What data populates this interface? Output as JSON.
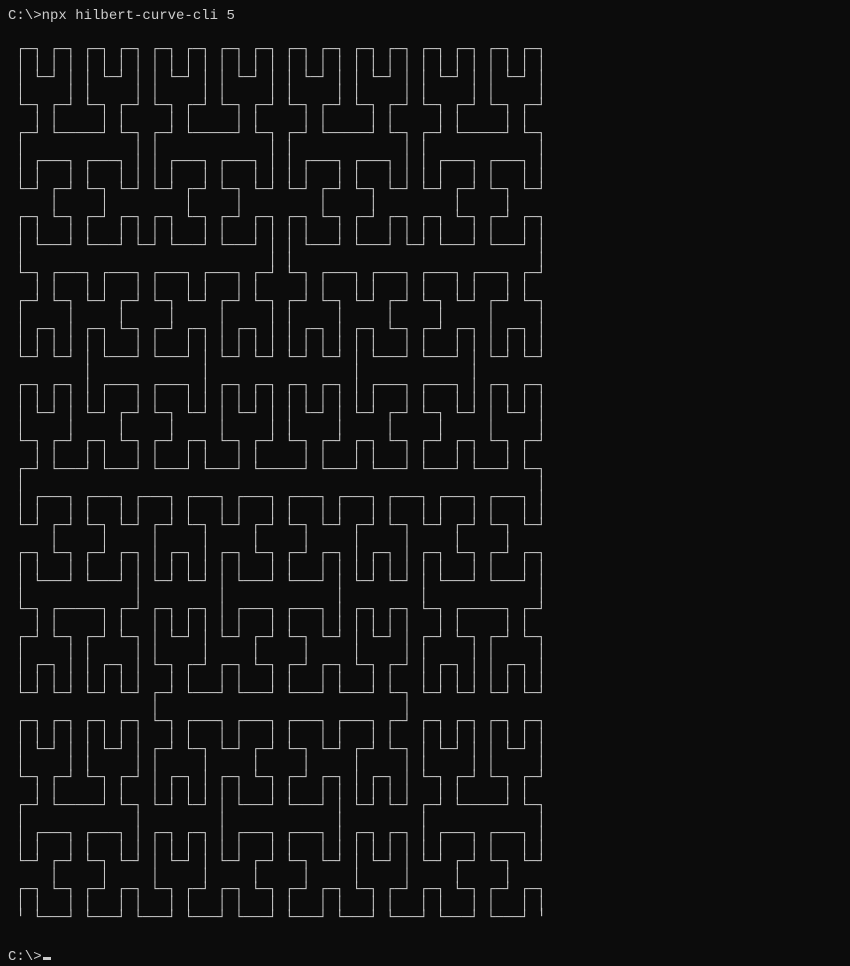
{
  "terminal": {
    "prompt": "C:\\>",
    "command": "npx hilbert-curve-cli 5",
    "cursor_prompt": "C:\\>",
    "hilbert_order": 5
  }
}
